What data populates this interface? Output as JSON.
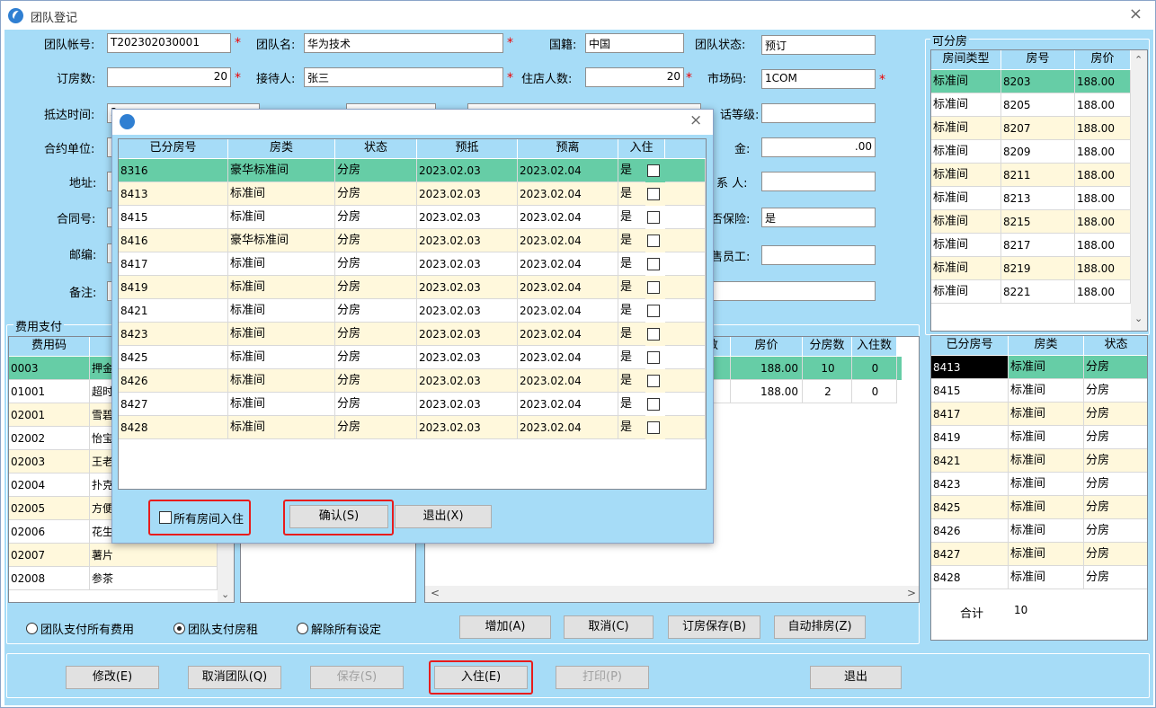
{
  "window": {
    "title": "团队登记",
    "close": "×"
  },
  "form": {
    "account_label": "团队帐号:",
    "account": "T202302030001",
    "name_label": "团队名:",
    "name": "华为技术",
    "nation_label": "国籍:",
    "nation": "中国",
    "status_label": "团队状态:",
    "status": "预订",
    "rooms_label": "订房数:",
    "rooms": "20",
    "host_label": "接待人:",
    "host": "张三",
    "guests_label": "住店人数:",
    "guests": "20",
    "market_label": "市场码:",
    "market": "1COM",
    "arrive_label": "抵达时间:",
    "arrive": "2",
    "level_label": "话等级:",
    "level": "",
    "contract_unit_label": "合约单位:",
    "deposit_label": "金:",
    "deposit": ".00",
    "address_label": "地址:",
    "contact_label": "系 人:",
    "contact": "",
    "contract_no_label": "合同号:",
    "insurance_label": "否保险:",
    "insurance": "是",
    "zip_label": "邮编:",
    "staff_label": "售员工:",
    "staff": "",
    "remark_label": "备注:",
    "required": "*"
  },
  "fee": {
    "title": "费用支付",
    "header": "费用码",
    "rows": [
      {
        "code": "0003",
        "name": "押金"
      },
      {
        "code": "01001",
        "name": "超时"
      },
      {
        "code": "02001",
        "name": "雪碧"
      },
      {
        "code": "02002",
        "name": "怡宝"
      },
      {
        "code": "02003",
        "name": "王老"
      },
      {
        "code": "02004",
        "name": "扑克"
      },
      {
        "code": "02005",
        "name": "方便"
      },
      {
        "code": "02006",
        "name": "花生"
      },
      {
        "code": "02007",
        "name": "薯片"
      },
      {
        "code": "02008",
        "name": "参茶"
      }
    ],
    "options": [
      "团队支付所有费用",
      "团队支付房租",
      "解除所有设定"
    ],
    "selected_option": "团队支付房租"
  },
  "room_type_table": {
    "headers": [
      "数",
      "房价",
      "分房数",
      "入住数"
    ],
    "rows": [
      {
        "price": "188.00",
        "assigned": "10",
        "checkedin": "0"
      },
      {
        "price": "188.00",
        "assigned": "2",
        "checkedin": "0"
      }
    ],
    "buttons": [
      "增加(A)",
      "取消(C)",
      "订房保存(B)",
      "自动排房(Z)"
    ]
  },
  "available": {
    "title": "可分房",
    "headers": [
      "房间类型",
      "房号",
      "房价"
    ],
    "rows": [
      [
        "标准间",
        "8203",
        "188.00"
      ],
      [
        "标准间",
        "8205",
        "188.00"
      ],
      [
        "标准间",
        "8207",
        "188.00"
      ],
      [
        "标准间",
        "8209",
        "188.00"
      ],
      [
        "标准间",
        "8211",
        "188.00"
      ],
      [
        "标准间",
        "8213",
        "188.00"
      ],
      [
        "标准间",
        "8215",
        "188.00"
      ],
      [
        "标准间",
        "8217",
        "188.00"
      ],
      [
        "标准间",
        "8219",
        "188.00"
      ],
      [
        "标准间",
        "8221",
        "188.00"
      ]
    ]
  },
  "assigned": {
    "headers": [
      "已分房号",
      "房类",
      "状态"
    ],
    "rows": [
      [
        "8413",
        "标准间",
        "分房"
      ],
      [
        "8415",
        "标准间",
        "分房"
      ],
      [
        "8417",
        "标准间",
        "分房"
      ],
      [
        "8419",
        "标准间",
        "分房"
      ],
      [
        "8421",
        "标准间",
        "分房"
      ],
      [
        "8423",
        "标准间",
        "分房"
      ],
      [
        "8425",
        "标准间",
        "分房"
      ],
      [
        "8426",
        "标准间",
        "分房"
      ],
      [
        "8427",
        "标准间",
        "分房"
      ],
      [
        "8428",
        "标准间",
        "分房"
      ]
    ],
    "total_label": "合计",
    "total": "10"
  },
  "bottom_buttons": {
    "modify": "修改(E)",
    "cancel_team": "取消团队(Q)",
    "save": "保存(S)",
    "checkin": "入住(E)",
    "print": "打印(P)",
    "exit": "退出"
  },
  "dialog": {
    "close": "×",
    "headers": [
      "已分房号",
      "房类",
      "状态",
      "预抵",
      "预离",
      "入住"
    ],
    "rows": [
      [
        "8316",
        "豪华标准间",
        "分房",
        "2023.02.03",
        "2023.02.04",
        "是"
      ],
      [
        "8413",
        "标准间",
        "分房",
        "2023.02.03",
        "2023.02.04",
        "是"
      ],
      [
        "8415",
        "标准间",
        "分房",
        "2023.02.03",
        "2023.02.04",
        "是"
      ],
      [
        "8416",
        "豪华标准间",
        "分房",
        "2023.02.03",
        "2023.02.04",
        "是"
      ],
      [
        "8417",
        "标准间",
        "分房",
        "2023.02.03",
        "2023.02.04",
        "是"
      ],
      [
        "8419",
        "标准间",
        "分房",
        "2023.02.03",
        "2023.02.04",
        "是"
      ],
      [
        "8421",
        "标准间",
        "分房",
        "2023.02.03",
        "2023.02.04",
        "是"
      ],
      [
        "8423",
        "标准间",
        "分房",
        "2023.02.03",
        "2023.02.04",
        "是"
      ],
      [
        "8425",
        "标准间",
        "分房",
        "2023.02.03",
        "2023.02.04",
        "是"
      ],
      [
        "8426",
        "标准间",
        "分房",
        "2023.02.03",
        "2023.02.04",
        "是"
      ],
      [
        "8427",
        "标准间",
        "分房",
        "2023.02.03",
        "2023.02.04",
        "是"
      ],
      [
        "8428",
        "标准间",
        "分房",
        "2023.02.03",
        "2023.02.04",
        "是"
      ]
    ],
    "all_checkin": "所有房间入住",
    "confirm": "确认(S)",
    "exit": "退出(X)"
  },
  "colors": {
    "client_bg": "#a6dcf7",
    "selected_row": "#66cda6",
    "alt_row": "#fff8dc",
    "highlight": "#e81c1c"
  }
}
